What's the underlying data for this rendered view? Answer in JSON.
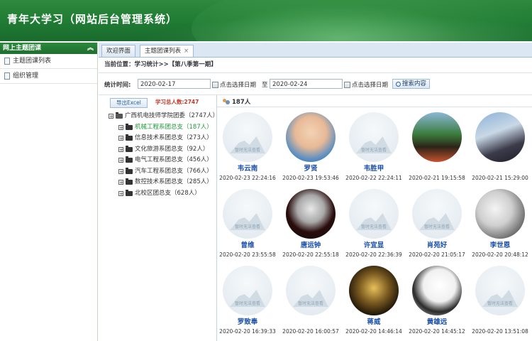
{
  "header": {
    "title": "青年大学习（网站后台管理系统）"
  },
  "sidebar": {
    "title": "网上主题团课",
    "collapse_glyph": "︽",
    "items": [
      {
        "label": "主题团课列表"
      },
      {
        "label": "组织管理"
      }
    ]
  },
  "tabs": [
    {
      "label": "欢迎界面",
      "active": false
    },
    {
      "label": "主题团课列表",
      "active": true,
      "close": "×"
    }
  ],
  "breadcrumb": "当前位置：学习统计>>【第八季第一期】",
  "filter": {
    "label": "统计时间:",
    "start_date": "2020-02-17",
    "end_date": "2020-02-24",
    "pick_label": "点击选择日期",
    "to_label": "至",
    "search_label": "搜索内容"
  },
  "tree_panel": {
    "export_label": "导出Excel",
    "total_label": "学习总人数:2747",
    "root": {
      "label": "广西机电技师学院团委（2747人）"
    },
    "children": [
      {
        "label": "机械工程系团总支（187人）",
        "selected": true
      },
      {
        "label": "信息技术系团总支（273人）"
      },
      {
        "label": "文化旅游系团总支（92人）"
      },
      {
        "label": "电气工程系团总支（456人）"
      },
      {
        "label": "汽车工程系团总支（766人）"
      },
      {
        "label": "数控技术系团总支（285人）"
      },
      {
        "label": "北校区团总支（628人）"
      }
    ]
  },
  "grid": {
    "count_label": "187人",
    "placeholder_text": "暂时无法查看",
    "users": [
      {
        "name": "韦云南",
        "time": "2020-02-23 22:24:16",
        "avatar": "placeholder"
      },
      {
        "name": "罗贤",
        "time": "2020-02-23 19:53:46",
        "avatar": "p1"
      },
      {
        "name": "韦胜甲",
        "time": "2020-02-22 22:24:11",
        "avatar": "placeholder"
      },
      {
        "name": "",
        "time": "2020-02-21 19:15:58",
        "avatar": "p2"
      },
      {
        "name": "",
        "time": "2020-02-21 15:29:00",
        "avatar": "p3"
      },
      {
        "name": "曾维",
        "time": "2020-02-20 23:55:58",
        "avatar": "placeholder"
      },
      {
        "name": "唐运钟",
        "time": "2020-02-20 22:55:18",
        "avatar": "p4"
      },
      {
        "name": "许宜显",
        "time": "2020-02-20 22:36:39",
        "avatar": "placeholder"
      },
      {
        "name": "肖苑好",
        "time": "2020-02-20 21:05:17",
        "avatar": "placeholder"
      },
      {
        "name": "李世恩",
        "time": "2020-02-20 20:48:12",
        "avatar": "p5"
      },
      {
        "name": "罗致奉",
        "time": "2020-02-20 16:39:33",
        "avatar": "placeholder"
      },
      {
        "name": "",
        "time": "2020-02-20 16:00:57",
        "avatar": "placeholder"
      },
      {
        "name": "蒋威",
        "time": "2020-02-20 14:46:14",
        "avatar": "p6"
      },
      {
        "name": "黄雄远",
        "time": "2020-02-20 14:45:12",
        "avatar": "p7"
      },
      {
        "name": "",
        "time": "2020-02-20 13:51:08",
        "avatar": "placeholder"
      }
    ]
  }
}
